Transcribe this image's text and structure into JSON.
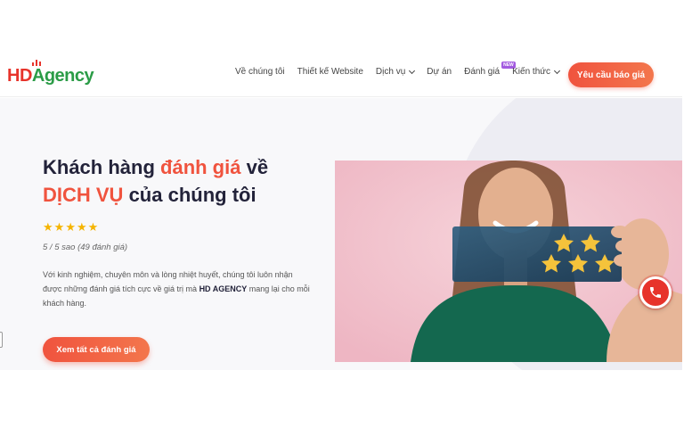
{
  "header": {
    "logo_hd": "HD",
    "logo_agency": "Agency",
    "nav": [
      {
        "label": "Về chúng tôi",
        "dropdown": false
      },
      {
        "label": "Thiết kế Website",
        "dropdown": false
      },
      {
        "label": "Dịch vụ",
        "dropdown": true
      },
      {
        "label": "Dự án",
        "dropdown": false
      },
      {
        "label": "Đánh giá",
        "dropdown": false,
        "badge": "NEW"
      },
      {
        "label": "Kiến thức",
        "dropdown": true
      }
    ],
    "cta_label": "Yêu cầu báo giá"
  },
  "hero": {
    "title_part1": "Khách hàng ",
    "title_accent1": "đánh giá",
    "title_part2": " về",
    "title_accent2": "DỊCH VỤ",
    "title_part3": " của chúng tôi",
    "stars": 5,
    "rating_text": "5 / 5 sao (49 đánh giá)",
    "desc_part1": "Với kinh nghiệm, chuyên môn và lòng nhiệt huyết, chúng tôi luôn nhận được những đánh giá tích cực về giá trị mà ",
    "desc_bold": "HD AGENCY",
    "desc_part2": " mang lại cho mỗi khách hàng.",
    "cta_label": "Xem tất cả đánh giá"
  },
  "colors": {
    "accent": "#f0533e",
    "brand_green": "#2b9c47",
    "star": "#f5b400"
  },
  "icons": {
    "phone": "phone-icon",
    "star": "star-icon",
    "chevron": "chevron-down-icon"
  }
}
